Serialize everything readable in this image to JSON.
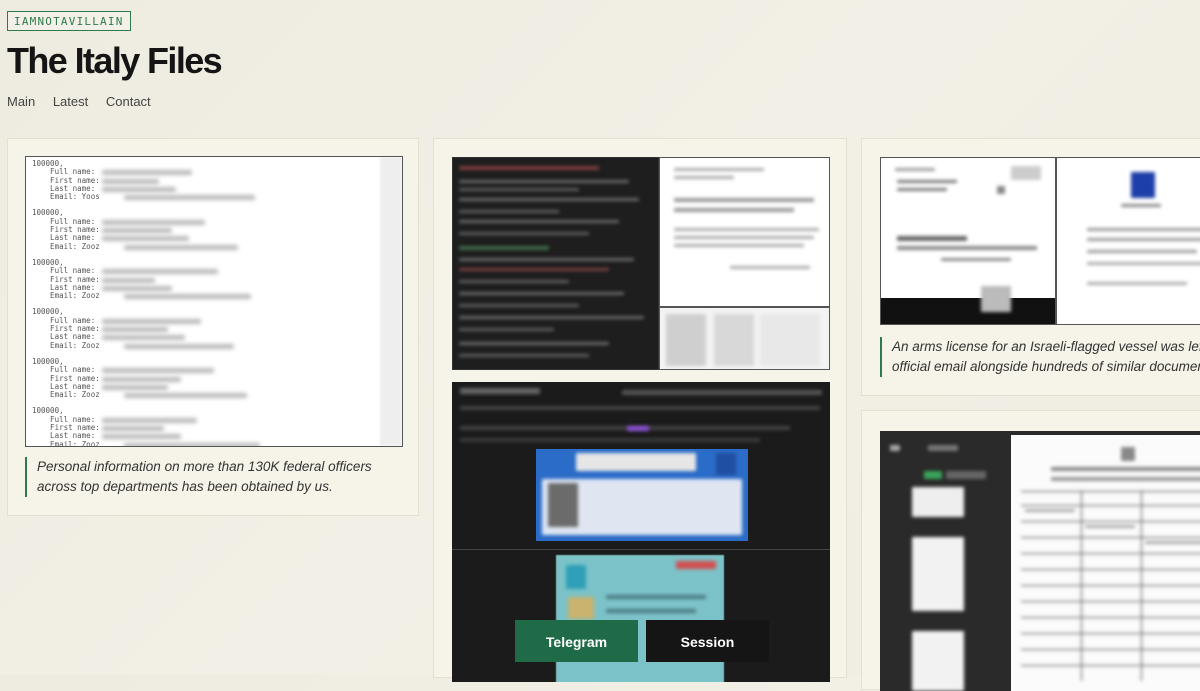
{
  "site": {
    "badge": "IAMNOTAVILLAIN",
    "title": "The Italy Files"
  },
  "nav": [
    {
      "label": "Main"
    },
    {
      "label": "Latest"
    },
    {
      "label": "Contact"
    }
  ],
  "cards": [
    {
      "caption": "Personal information on more than 130K federal officers across top departments has been obtained by us.",
      "record_id": "100000,",
      "field_labels": [
        "Full name:",
        "First name:",
        "Last name:",
        "Email:"
      ],
      "email_prefix": "Yoos",
      "email_prefix_alt": "Zooz"
    },
    {
      "caption": ""
    },
    {
      "caption": "An arms license for an Israeli-flagged vessel was left in official email alongside hundreds of similar documents."
    }
  ],
  "actions": {
    "telegram_label": "Telegram",
    "session_label": "Session"
  },
  "colors": {
    "accent": "#2f7a4d",
    "telegram_bg": "#1f6b47",
    "session_bg": "#151515"
  }
}
